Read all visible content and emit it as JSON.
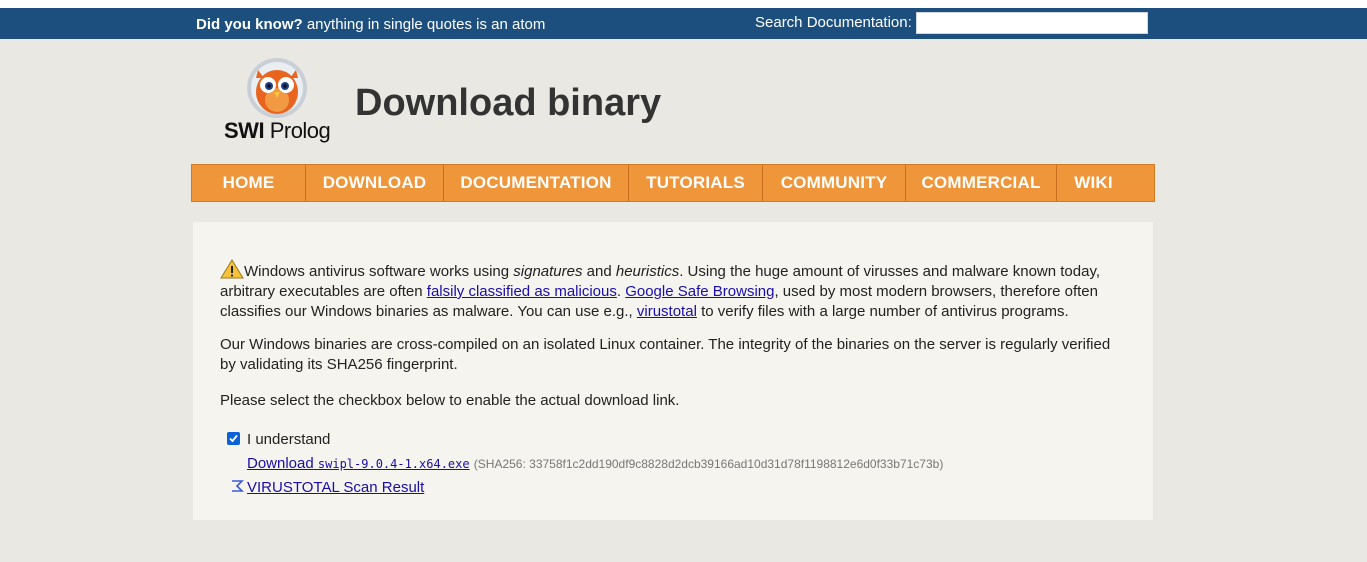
{
  "topbar": {
    "didyouknow_label": "Did you know?",
    "didyouknow_text": " anything in single quotes is an atom",
    "search_label": "Search Documentation:",
    "search_value": ""
  },
  "logo": {
    "swi": "SWI",
    "prolog": "Prolog"
  },
  "page": {
    "title": "Download binary"
  },
  "nav": {
    "items": [
      "HOME",
      "DOWNLOAD",
      "DOCUMENTATION",
      "TUTORIALS",
      "COMMUNITY",
      "COMMERCIAL",
      "WIKI"
    ]
  },
  "notice": {
    "p1_a": "Windows antivirus software works using ",
    "p1_signatures": "signatures",
    "p1_b": " and ",
    "p1_heuristics": "heuristics",
    "p1_c": ". Using the huge amount of virusses and malware known today, arbitrary executables are often ",
    "link_falsely": "falsily classified as malicious",
    "p1_d": ". ",
    "link_google": "Google Safe Browsing",
    "p1_e": ", used by most modern browsers, therefore often classifies our Windows binaries as malware. You can use e.g., ",
    "link_virustotal": "virustotal",
    "p1_f": " to verify files with a large number of antivirus programs.",
    "p2": "Our Windows binaries are cross-compiled on an isolated Linux container. The integrity of the binaries on the server is regularly verified by validating its SHA256 fingerprint.",
    "p3": "Please select the checkbox below to enable the actual download link.",
    "checkbox_label": "I understand",
    "download_label": "Download",
    "download_file": "swipl-9.0.4-1.x64.exe",
    "sha_text": "(SHA256: 33758f1c2dd190df9c8828d2dcb39166ad10d31d78f1198812e6d0f33b71c73b)",
    "virustotal_result": "VIRUSTOTAL Scan Result",
    "checkbox_checked": true
  },
  "colors": {
    "topbar": "#1d4f7e",
    "nav": "#f0963a",
    "link": "#1a0dab",
    "checkbox": "#0b62d6"
  }
}
